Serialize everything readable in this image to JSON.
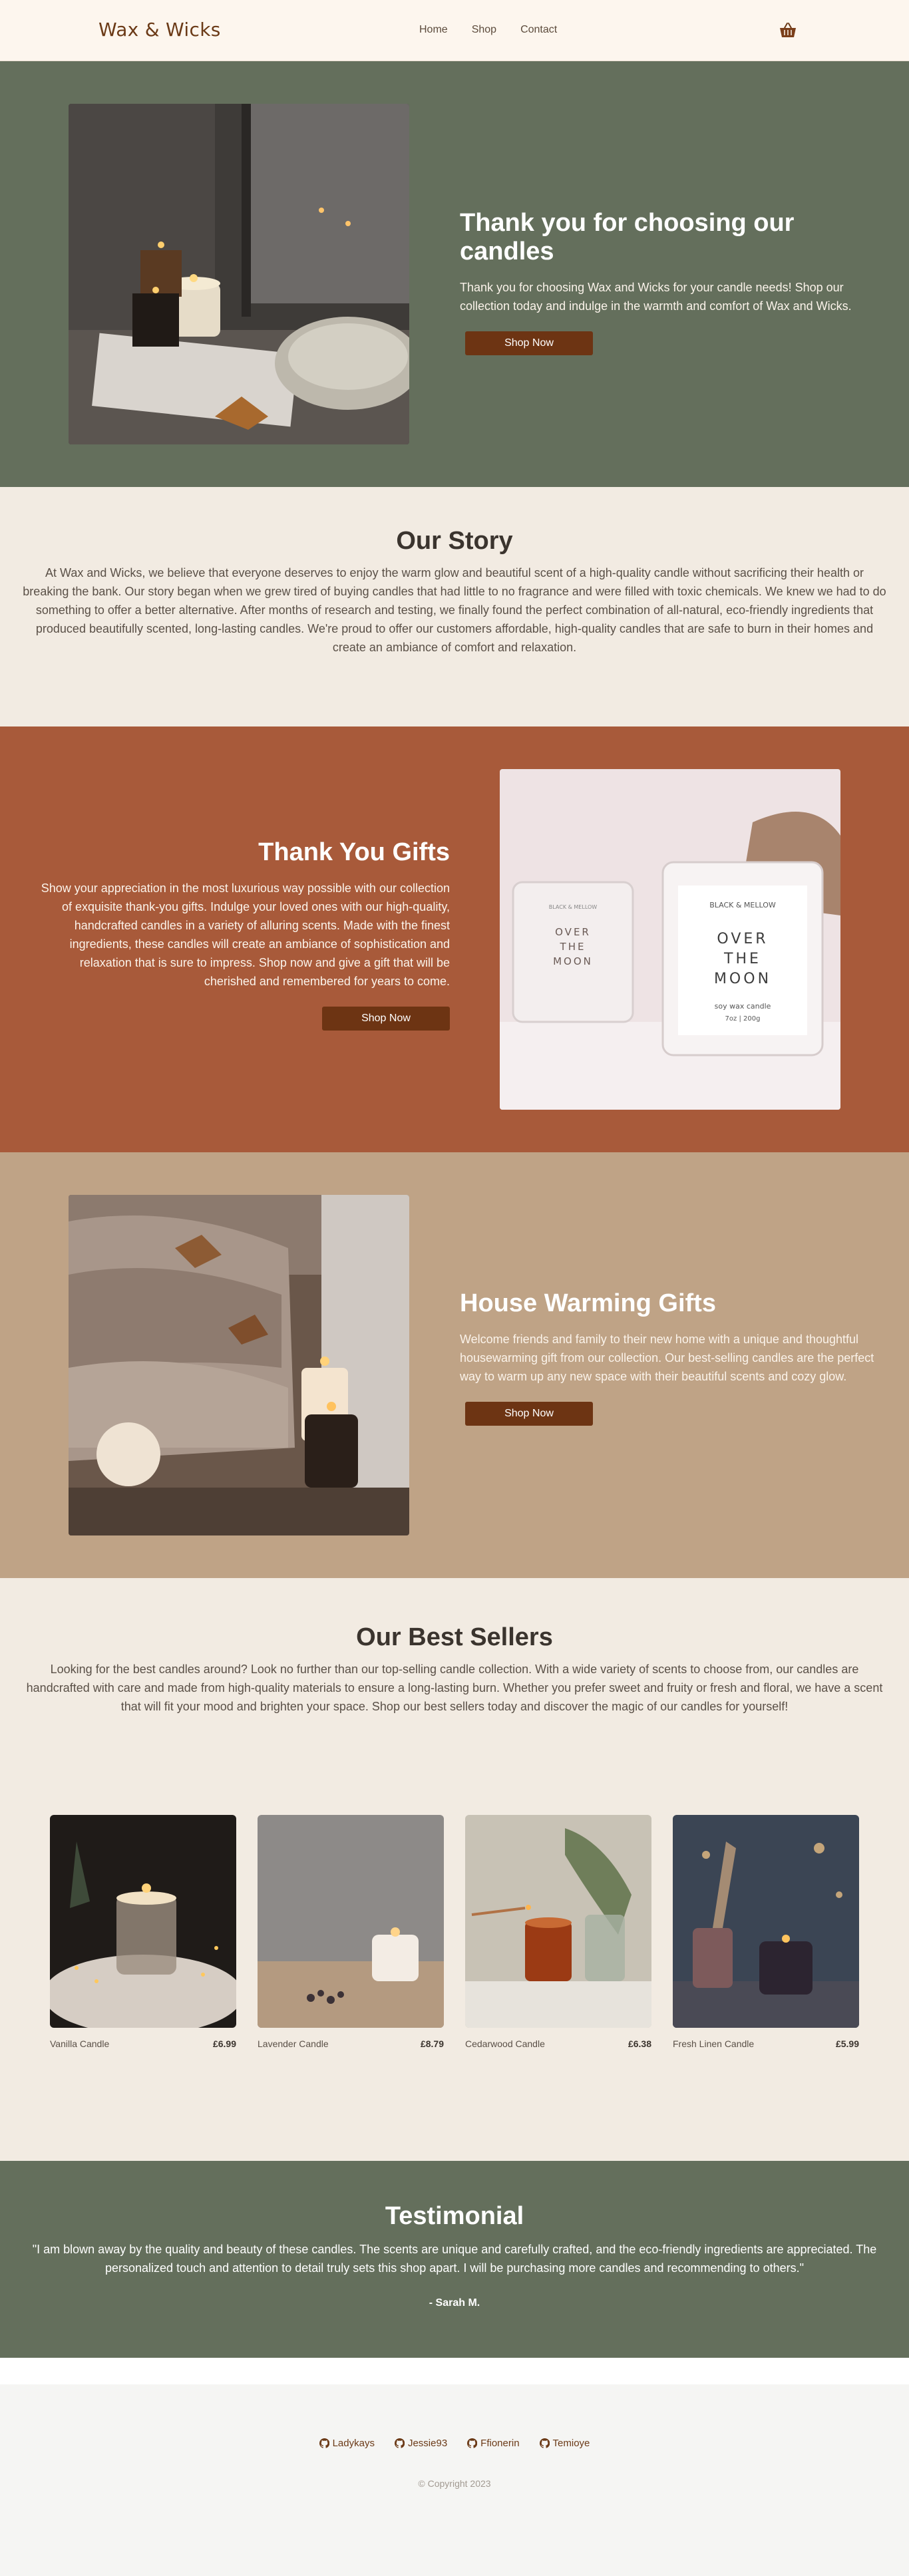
{
  "nav": {
    "brand": "Wax & Wicks",
    "links": [
      "Home",
      "Shop",
      "Contact"
    ],
    "cart_icon": "basket-icon"
  },
  "hero": {
    "title": "Thank you for choosing our candles",
    "text": "Thank you for choosing Wax and Wicks for your candle needs! Shop our collection today and indulge in the warmth and comfort of Wax and Wicks.",
    "button": "Shop Now"
  },
  "story": {
    "title": "Our Story",
    "text": "At Wax and Wicks, we believe that everyone deserves to enjoy the warm glow and beautiful scent of a high-quality candle without sacrificing their health or breaking the bank. Our story began when we grew tired of buying candles that had little to no fragrance and were filled with toxic chemicals. We knew we had to do something to offer a better alternative. After months of research and testing, we finally found the perfect combination of all-natural, eco-friendly ingredients that produced beautifully scented, long-lasting candles. We're proud to offer our customers affordable, high-quality candles that are safe to burn in their homes and create an ambiance of comfort and relaxation."
  },
  "gifts": {
    "title": "Thank You Gifts",
    "text": "Show your appreciation in the most luxurious way possible with our collection of exquisite thank-you gifts. Indulge your loved ones with our high-quality, handcrafted candles in a variety of alluring scents. Made with the finest ingredients, these candles will create an ambiance of sophistication and relaxation that is sure to impress. Shop now and give a gift that will be cherished and remembered for years to come.",
    "button": "Shop Now",
    "jar_brand": "BLACK & MELLOW",
    "jar_title_1": "OVER",
    "jar_title_2": "THE",
    "jar_title_3": "MOON",
    "jar_sub_1": "soy wax candle",
    "jar_sub_2": "7oz | 200g"
  },
  "housewarming": {
    "title": "House Warming Gifts",
    "text": "Welcome friends and family to their new home with a unique and thoughtful housewarming gift from our collection. Our best-selling candles are the perfect way to warm up any new space with their beautiful scents and cozy glow.",
    "button": "Shop Now"
  },
  "best": {
    "title": "Our Best Sellers",
    "text": "Looking for the best candles around? Look no further than our top-selling candle collection. With a wide variety of scents to choose from, our candles are handcrafted with care and made from high-quality materials to ensure a long-lasting burn. Whether you prefer sweet and fruity or fresh and floral, we have a scent that will fit your mood and brighten your space. Shop our best sellers today and discover the magic of our candles for yourself!",
    "products": [
      {
        "name": "Vanilla Candle",
        "price": "£6.99"
      },
      {
        "name": "Lavender Candle",
        "price": "£8.79"
      },
      {
        "name": "Cedarwood Candle",
        "price": "£6.38"
      },
      {
        "name": "Fresh Linen Candle",
        "price": "£5.99"
      }
    ]
  },
  "testimonial": {
    "title": "Testimonial",
    "quote": "\"I am blown away by the quality and beauty of these candles. The scents are unique and carefully crafted, and the eco-friendly ingredients are appreciated. The personalized touch and attention to detail truly sets this shop apart. I will be purchasing more candles and recommending to others.\"",
    "author": "- Sarah M."
  },
  "footer": {
    "links": [
      "Ladykays",
      "Jessie93",
      "Ffionerin",
      "Temioye"
    ],
    "link_icon": "github-icon",
    "copyright": "© Copyright 2023"
  },
  "colors": {
    "green": "#646f5c",
    "rust": "#a85a3a",
    "tan": "#bfa386",
    "button": "#6d3413",
    "cream": "#f2ebe2"
  }
}
